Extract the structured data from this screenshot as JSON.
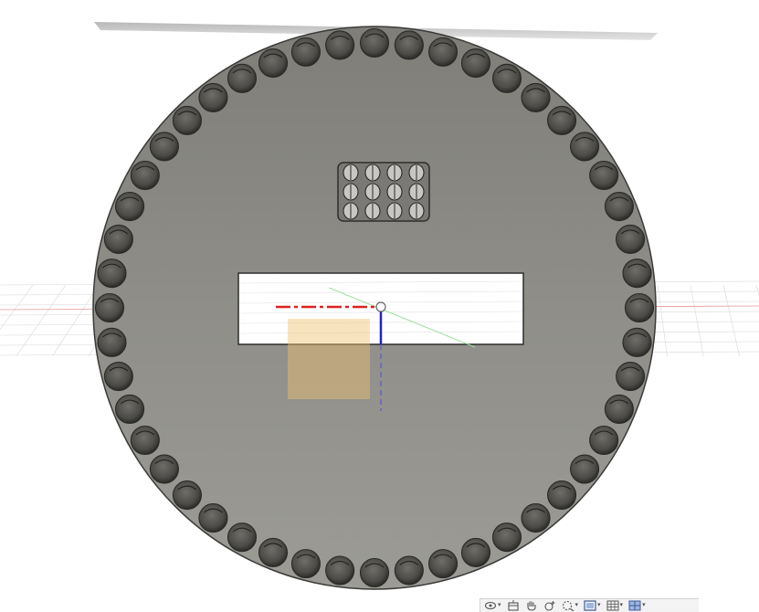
{
  "app": {
    "view": "3d-viewport",
    "background_color": "#ffffff",
    "model_color": "#8e8d88"
  },
  "model": {
    "perimeter_holes": 48,
    "pin_grid": {
      "rows": 3,
      "columns": 4
    }
  },
  "nav_toolbar": {
    "buttons": [
      {
        "name": "orbit",
        "icon": "orbit-icon",
        "has_dropdown": true
      },
      {
        "name": "look-at",
        "icon": "look-at-icon",
        "has_dropdown": false
      },
      {
        "name": "pan",
        "icon": "pan-hand-icon",
        "has_dropdown": false
      },
      {
        "name": "zoom",
        "icon": "zoom-icon",
        "has_dropdown": false
      },
      {
        "name": "fit",
        "icon": "fit-view-icon",
        "has_dropdown": true
      },
      {
        "name": "display-settings",
        "icon": "display-settings-icon",
        "has_dropdown": true
      },
      {
        "name": "grid-and-snaps",
        "icon": "grid-icon",
        "has_dropdown": true
      },
      {
        "name": "viewports",
        "icon": "viewports-icon",
        "has_dropdown": true
      }
    ]
  }
}
